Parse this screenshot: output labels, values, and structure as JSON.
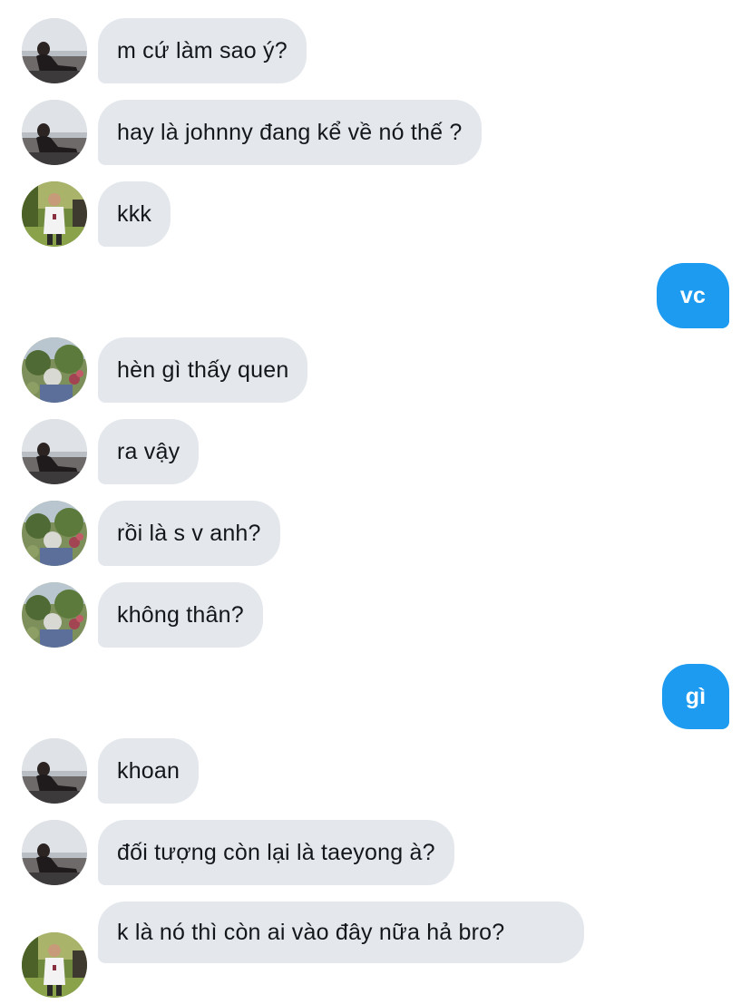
{
  "conversation": {
    "messages": [
      {
        "direction": "incoming",
        "sender_avatar": "avatar-sitting-by-window",
        "text": "m cứ làm sao ý?"
      },
      {
        "direction": "incoming",
        "sender_avatar": "avatar-sitting-by-window",
        "text": "hay là johnny đang kể về nó thế ?"
      },
      {
        "direction": "incoming",
        "sender_avatar": "avatar-person-in-garden",
        "text": "kkk"
      },
      {
        "direction": "outgoing",
        "text": "vc"
      },
      {
        "direction": "incoming",
        "sender_avatar": "avatar-flower-landscape",
        "text": "hèn gì thấy quen"
      },
      {
        "direction": "incoming",
        "sender_avatar": "avatar-sitting-by-window",
        "text": "ra vậy"
      },
      {
        "direction": "incoming",
        "sender_avatar": "avatar-flower-landscape",
        "text": "rồi là s v anh?"
      },
      {
        "direction": "incoming",
        "sender_avatar": "avatar-flower-landscape",
        "text": "không thân?"
      },
      {
        "direction": "outgoing",
        "text": "gì"
      },
      {
        "direction": "incoming",
        "sender_avatar": "avatar-sitting-by-window",
        "text": "khoan"
      },
      {
        "direction": "incoming",
        "sender_avatar": "avatar-sitting-by-window",
        "text": "đối tượng còn lại là taeyong à?"
      },
      {
        "direction": "incoming",
        "sender_avatar": "avatar-person-in-garden",
        "text": "k là nó thì còn ai vào đây nữa hả bro?"
      }
    ]
  },
  "colors": {
    "incoming_bubble": "#e4e8ed",
    "incoming_text": "#14171a",
    "outgoing_bubble": "#1d9bf0",
    "outgoing_text": "#ffffff",
    "background": "#ffffff"
  }
}
